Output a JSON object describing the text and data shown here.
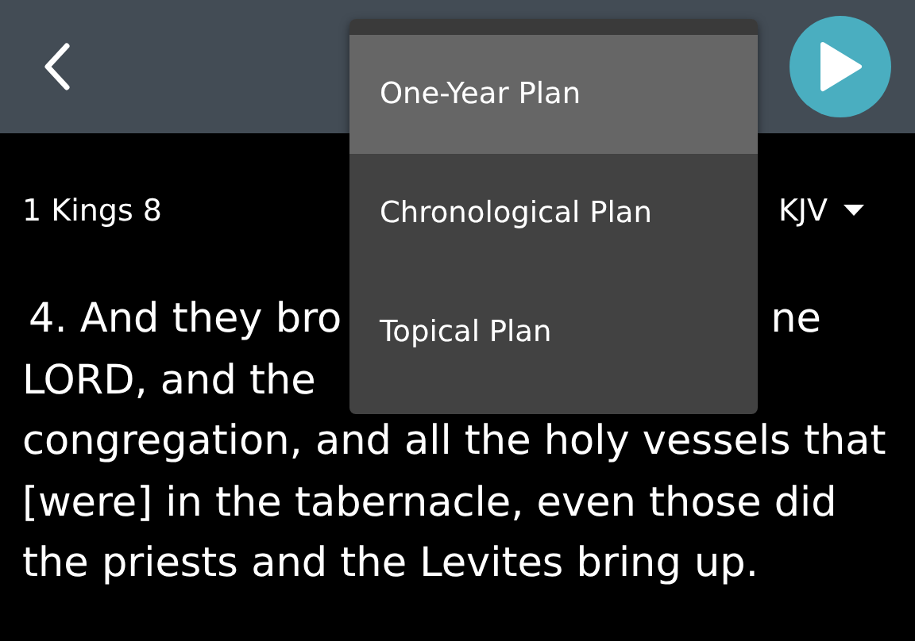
{
  "menu": {
    "items": [
      {
        "label": "One-Year Plan",
        "selected": true
      },
      {
        "label": "Chronological Plan",
        "selected": false
      },
      {
        "label": "Topical Plan",
        "selected": false
      }
    ]
  },
  "subheader": {
    "chapter": "1 Kings 8",
    "version": "KJV"
  },
  "verse_lines": [
    {
      "parts": [
        "4. And they bro",
        "ne"
      ]
    },
    {
      "parts": [
        "LORD, and the"
      ]
    },
    {
      "parts": [
        "congregation, and all the holy vessels that"
      ]
    },
    {
      "parts": [
        "[were] in the tabernacle, even those did"
      ]
    },
    {
      "parts": [
        "the priests and the Levites bring up."
      ]
    }
  ]
}
